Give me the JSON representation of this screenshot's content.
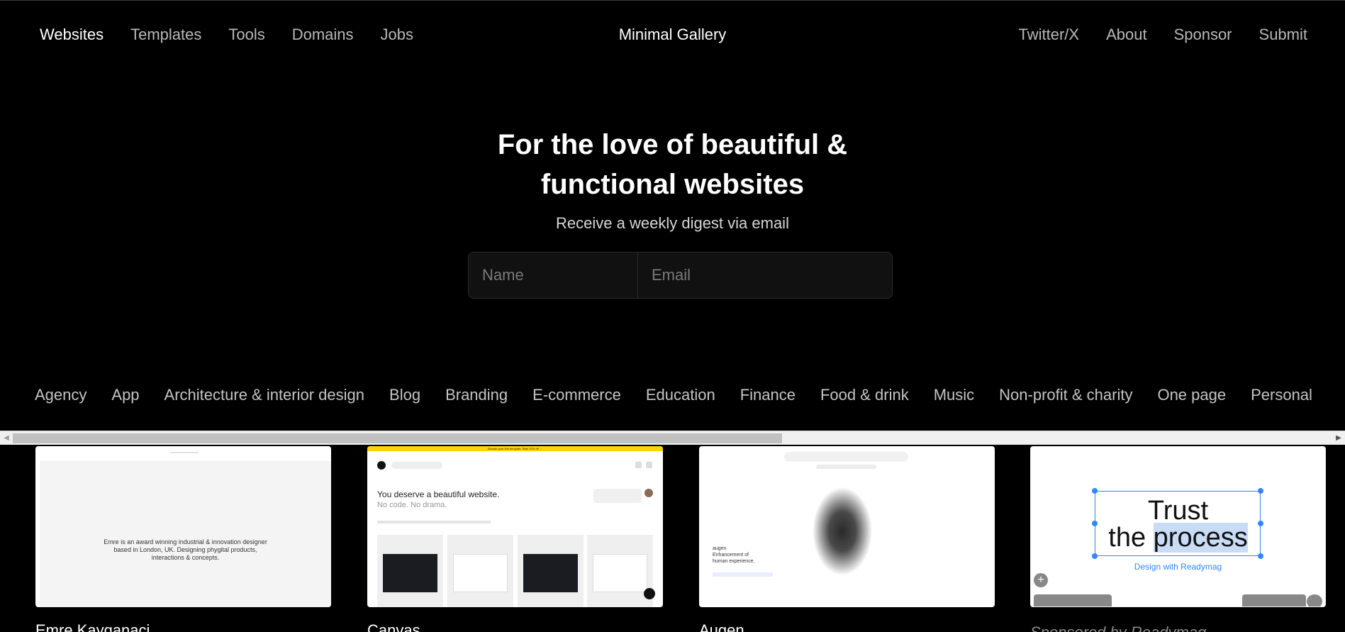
{
  "nav": {
    "left": [
      "Websites",
      "Templates",
      "Tools",
      "Domains",
      "Jobs"
    ],
    "brand": "Minimal Gallery",
    "right": [
      "Twitter/X",
      "About",
      "Sponsor",
      "Submit"
    ]
  },
  "hero": {
    "title_line1": "For the love of beautiful &",
    "title_line2": "functional websites",
    "subtitle": "Receive a weekly digest via email"
  },
  "signup": {
    "name_placeholder": "Name",
    "email_placeholder": "Email"
  },
  "categories": [
    "Agency",
    "App",
    "Architecture & interior design",
    "Blog",
    "Branding",
    "E-commerce",
    "Education",
    "Finance",
    "Food & drink",
    "Music",
    "Non-profit & charity",
    "One page",
    "Personal"
  ],
  "cards": [
    {
      "title": "Emre Kayganaci",
      "blurb_line1": "Emre is an award winning industrial & innovation designer",
      "blurb_line2": "based in London, UK. Designing phygital products,",
      "blurb_line3": "interactions & concepts."
    },
    {
      "title": "Canvas",
      "banner": "Browse your first template. Start 10% off →",
      "headline": "You deserve a beautiful website.",
      "subhead": "No code. No drama."
    },
    {
      "title": "Augen",
      "text_line1": "augen",
      "text_line2": "Enhancement of",
      "text_line3": "human experience."
    }
  ],
  "sponsor": {
    "line1": "Trust",
    "line2_a": "the ",
    "line2_b": "process",
    "cta": "Design with Readymag",
    "label": "Sponsored by Readymag"
  },
  "colors": {
    "background": "#000000",
    "accent": "#2f88ff",
    "banner": "#ffd400"
  }
}
